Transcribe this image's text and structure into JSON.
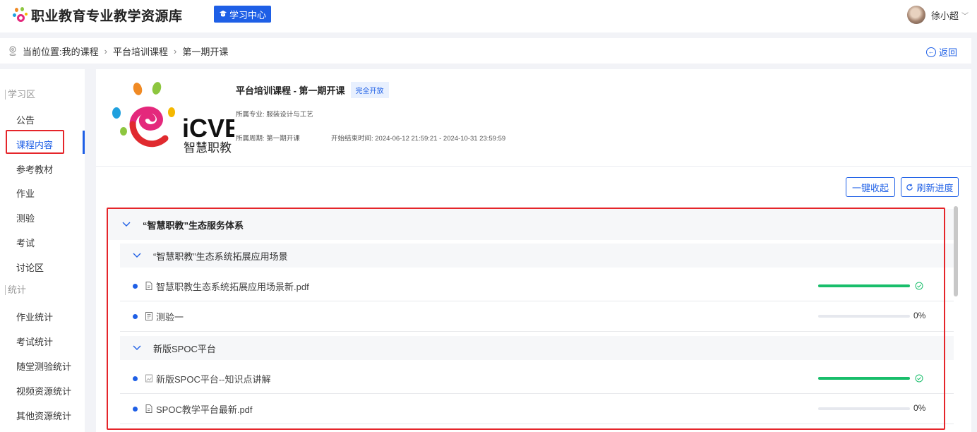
{
  "topbar": {
    "site_title": "职业教育专业教学资源库",
    "learn_center": "学习中心",
    "user_name": "徐小超"
  },
  "breadcrumb": {
    "prefix": "当前位置:",
    "items": [
      "我的课程",
      "平台培训课程",
      "第一期开课"
    ],
    "back_label": "返回"
  },
  "sidebar": {
    "groups": [
      {
        "title": "学习区",
        "items": [
          "公告",
          "课程内容",
          "参考教材",
          "作业",
          "测验",
          "考试",
          "讨论区"
        ]
      },
      {
        "title": "统计",
        "items": [
          "作业统计",
          "考试统计",
          "随堂测验统计",
          "视频资源统计",
          "其他资源统计"
        ]
      }
    ],
    "active_item": "课程内容"
  },
  "course": {
    "logo_text": "iCVE",
    "logo_subtext": "智慧职教",
    "title": "平台培训课程 - 第一期开课",
    "status_badge": "完全开放",
    "major": "所属专业: 服装设计与工艺",
    "period": "所属周期: 第一期开课",
    "time_range": "开始结束时间: 2024-06-12 21:59:21 - 2024-10-31 23:59:59"
  },
  "actions": {
    "collapse_all": "一键收起",
    "refresh_progress": "刷新进度"
  },
  "tree": {
    "chapter": "“智慧职教”生态服务体系",
    "sections": [
      {
        "title": "“智慧职教”生态系统拓展应用场景",
        "items": [
          {
            "name": "智慧职教生态系统拓展应用场景新.pdf",
            "icon": "pdf-icon",
            "progress": 100,
            "progress_text": ""
          },
          {
            "name": "测验一",
            "icon": "quiz-icon",
            "progress": 0,
            "progress_text": "0%"
          }
        ]
      },
      {
        "title": "新版SPOC平台",
        "items": [
          {
            "name": "新版SPOC平台--知识点讲解",
            "icon": "image-icon",
            "progress": 100,
            "progress_text": ""
          },
          {
            "name": "SPOC教学平台最新.pdf",
            "icon": "pdf-icon",
            "progress": 0,
            "progress_text": "0%"
          }
        ]
      }
    ]
  },
  "colors": {
    "accent": "#1e5fe6",
    "success": "#19be6b",
    "highlight": "#e5252a"
  }
}
